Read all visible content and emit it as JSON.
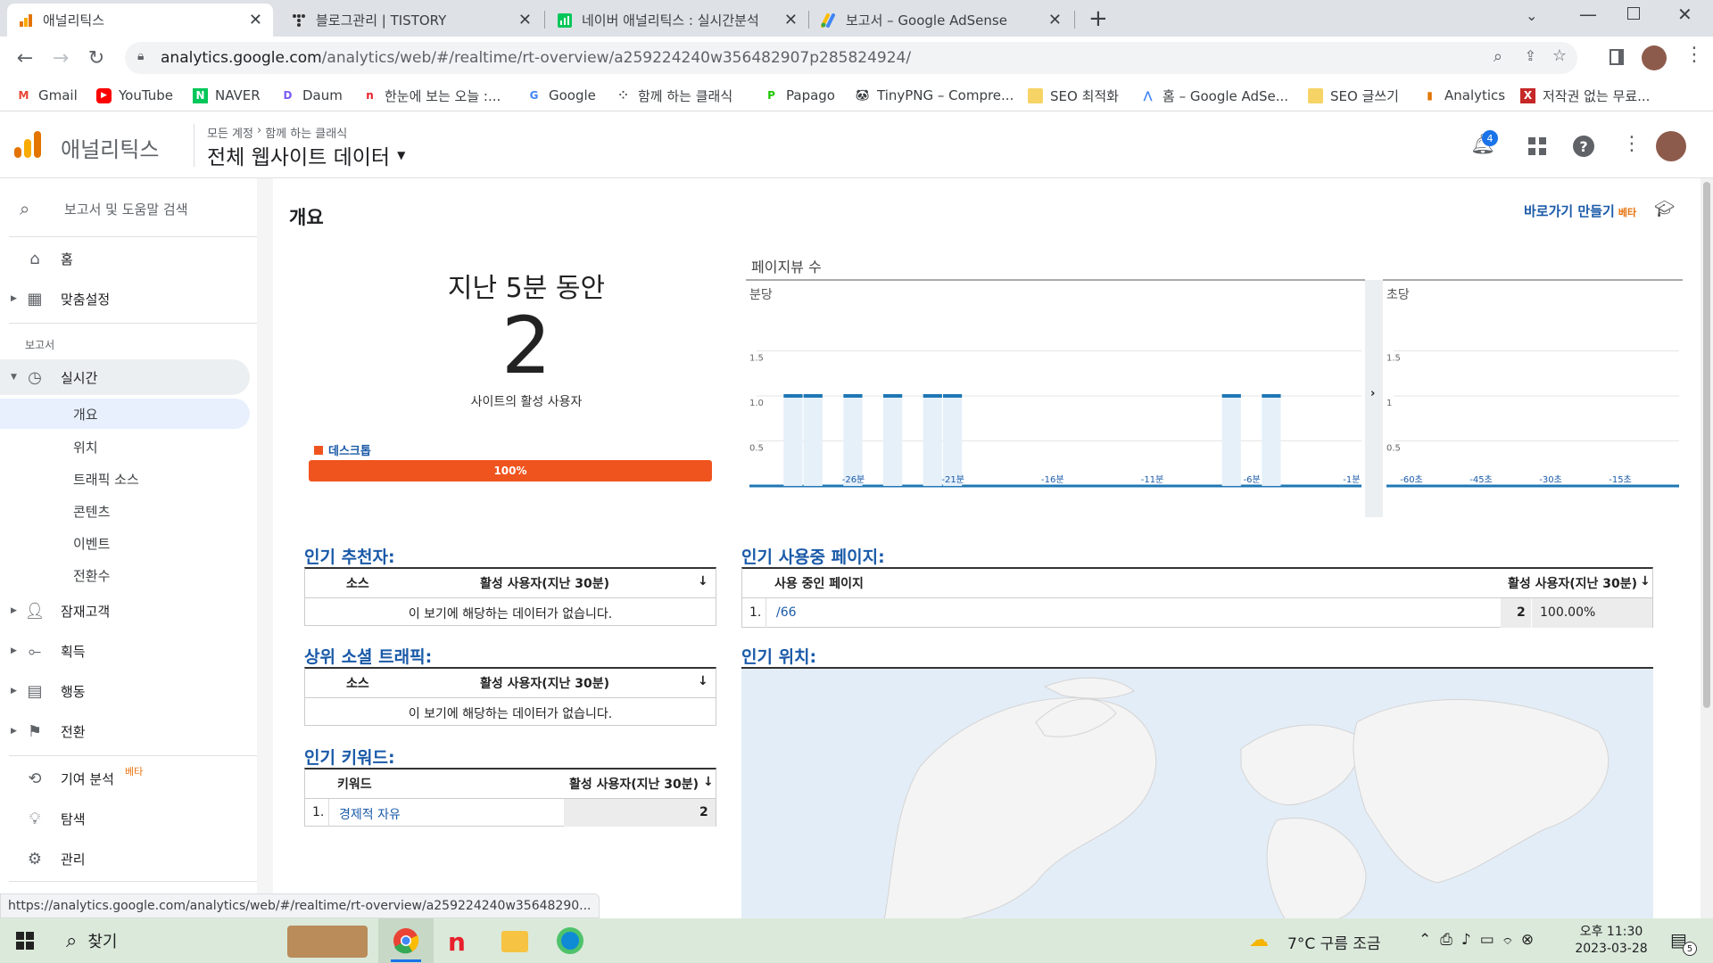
{
  "browser": {
    "tabs": [
      {
        "title": "애널리틱스"
      },
      {
        "title": "블로그관리 | TISTORY"
      },
      {
        "title": "네이버 애널리틱스 : 실시간분석"
      },
      {
        "title": "보고서 – Google AdSense"
      }
    ],
    "url_host": "analytics.google.com",
    "url_path": "/analytics/web/#/realtime/rt-overview/a259224240w356482907p285824924/",
    "bookmarks": [
      "Gmail",
      "YouTube",
      "NAVER",
      "Daum",
      "한눈에 보는 오늘 :...",
      "Google",
      "함께 하는 클래식",
      "Papago",
      "TinyPNG – Compre...",
      "SEO 최적화",
      "홈 – Google AdSe...",
      "SEO 글쓰기",
      "Analytics",
      "저작권 없는 무료..."
    ]
  },
  "header": {
    "product": "애널리틱스",
    "crumb_account": "모든 계정",
    "crumb_property": "함께 하는 클래식",
    "view_name": "전체 웹사이트 데이터",
    "notif_count": "4"
  },
  "sidebar": {
    "search": "보고서 및 도움말 검색",
    "home": "홈",
    "custom": "맞춤설정",
    "reports_label": "보고서",
    "realtime": "실시간",
    "sub": [
      "개요",
      "위치",
      "트래픽 소스",
      "콘텐츠",
      "이벤트",
      "전환수"
    ],
    "audience": "잠재고객",
    "acquisition": "획득",
    "behavior": "행동",
    "conversions": "전환",
    "attribution": "기여 분석",
    "attribution_badge": "베타",
    "discover": "탐색",
    "admin": "관리"
  },
  "main": {
    "title": "개요",
    "shortcut": "바로가기 만들기",
    "shortcut_badge": "베타",
    "period": "지난 5분 동안",
    "active_users": "2",
    "active_label": "사이트의 활성 사용자",
    "device_label": "데스크톱",
    "device_pct_label": "100%",
    "device_share": 1.0,
    "pageviews_title": "페이지뷰 수",
    "panel_min": "분당",
    "panel_sec": "초당",
    "referrers_title": "인기 추천자:",
    "social_title": "상위 소셜 트래픽:",
    "keywords_title": "인기 키워드:",
    "pages_title": "인기 사용중 페이지:",
    "locations_title": "인기 위치:",
    "col_source": "소스",
    "col_active": "활성 사용자(지난 30분)",
    "col_keyword": "키워드",
    "col_page": "사용 중인 페이지",
    "no_data": "이 보기에 해당하는 데이터가 없습니다.",
    "keywords": [
      {
        "idx": "1.",
        "kw": "경제적 자유",
        "val": "2"
      }
    ],
    "pages": [
      {
        "idx": "1.",
        "page": "/66",
        "val": "2",
        "pct": "100.00%"
      }
    ]
  },
  "chart_data": [
    {
      "type": "bar",
      "title": "분당",
      "x_ticks": [
        "-26분",
        "-21분",
        "-16분",
        "-11분",
        "-6분",
        "-1분"
      ],
      "y_ticks": [
        "0.5",
        "1.0",
        "1.5"
      ],
      "ylim": [
        0,
        2
      ],
      "x_range": [
        -30,
        0
      ],
      "x": [
        -29,
        -28,
        -26,
        -24,
        -22,
        -21,
        -7,
        -5
      ],
      "values": [
        1,
        1,
        1,
        1,
        1,
        1,
        1,
        1
      ]
    },
    {
      "type": "bar",
      "title": "초당",
      "x_ticks": [
        "-60초",
        "-45초",
        "-30초",
        "-15초"
      ],
      "y_ticks": [
        "0.5",
        "1",
        "1.5"
      ],
      "ylim": [
        0,
        2
      ],
      "values": []
    }
  ],
  "status_url": "https://analytics.google.com/analytics/web/#/realtime/rt-overview/a259224240w35648290...",
  "taskbar": {
    "search": "찾기",
    "weather": "7°C 구름 조금",
    "time": "오후 11:30",
    "date": "2023-03-28",
    "notif": "5"
  }
}
